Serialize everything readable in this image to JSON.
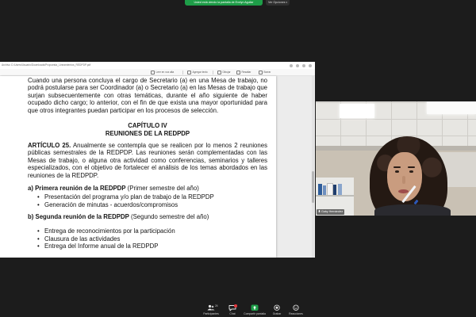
{
  "meeting": {
    "banner_text": "Usted está viendo la pantalla de Evelyn Aguilar",
    "view_options_label": "Ver Opciones",
    "accent_green": "#1e9d48",
    "badge_red": "#e0383e"
  },
  "browser": {
    "url": "Archivo  C:/Users/Usuario/Downloads/Propuesta_Lineamientos_REDPDP.pdf",
    "toolbar": [
      "Leer en voz alta",
      "Agregar texto",
      "Dibujar",
      "Resaltar",
      "Borrar"
    ]
  },
  "document": {
    "paragraph_1": "Cuando una persona concluya el cargo de Secretario (a) en una Mesa de trabajo, no podrá postularse para ser Coordinador (a) o Secretario (a) en las Mesas de trabajo que surjan subsecuentemente con otras temáticas, durante el año siguiente de haber ocupado dicho cargo; lo anterior, con el fin de que exista una mayor oportunidad para que otros integrantes puedan participar en los procesos de selección.",
    "chapter_title": "CAPÍTULO IV",
    "chapter_subtitle": "REUNIONES DE LA REDPDP",
    "article_label": "ARTÍCULO 25.",
    "article_text": "Anualmente se contempla que se realicen por lo menos 2 reuniones públicas semestrales de la REDPDP. Las reuniones serán complementadas con las Mesas de trabajo, o alguna otra actividad como conferencias, seminarios y talleres especializados, con el objetivo de fortalecer el análisis de los temas abordados en las reuniones de la REDPDP.",
    "sections": [
      {
        "heading": "a) Primera reunión de la REDPDP",
        "note": "(Primer semestre del año)",
        "items": [
          "Presentación del programa y/o plan de trabajo de la REDPDP",
          "Generación de minutas - acuerdos/compromisos"
        ]
      },
      {
        "heading": "b) Segunda reunión de la REDPDP",
        "note": "(Segundo semestre del año)",
        "items": [
          "Entrega de reconocimientos por la participación",
          "Clausura de las actividades",
          "Entrega del Informe anual de la REDPDP"
        ]
      }
    ]
  },
  "video": {
    "participant_name": "Gaby Hernández",
    "icon": "mic-icon"
  },
  "controls": [
    {
      "label": "Participantes",
      "count": "24",
      "icon": "participants-icon"
    },
    {
      "label": "Chat",
      "icon": "chat-icon"
    },
    {
      "label": "Compartir pantalla",
      "icon": "share-screen-icon"
    },
    {
      "label": "Grabar",
      "icon": "record-icon"
    },
    {
      "label": "Reacciones",
      "icon": "reactions-icon"
    }
  ]
}
